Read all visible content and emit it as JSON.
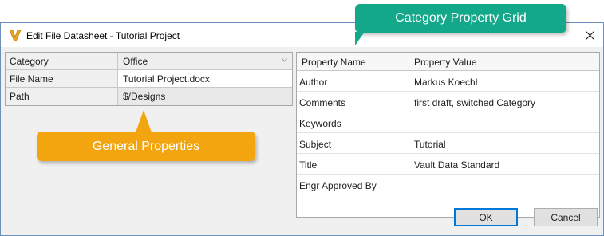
{
  "window": {
    "title": "Edit File Datasheet - Tutorial Project",
    "app_icon": "vault-icon",
    "close_icon": "close-icon"
  },
  "general_properties": {
    "rows": [
      {
        "name": "Category",
        "value": "Office",
        "type": "dropdown"
      },
      {
        "name": "File Name",
        "value": "Tutorial Project.docx",
        "type": "editable"
      },
      {
        "name": "Path",
        "value": "$/Designs",
        "type": "readonly"
      }
    ]
  },
  "property_grid": {
    "headers": {
      "name": "Property Name",
      "value": "Property Value"
    },
    "rows": [
      {
        "name": "Author",
        "value": "Markus Koechl"
      },
      {
        "name": "Comments",
        "value": "first draft, switched Category"
      },
      {
        "name": "Keywords",
        "value": ""
      },
      {
        "name": "Subject",
        "value": "Tutorial"
      },
      {
        "name": "Title",
        "value": "Vault Data Standard"
      },
      {
        "name": "Engr Approved By",
        "value": ""
      }
    ]
  },
  "buttons": {
    "ok": "OK",
    "cancel": "Cancel"
  },
  "callouts": {
    "category_grid": "Category Property Grid",
    "general": "General Properties",
    "colors": {
      "teal": "#14a88b",
      "orange": "#f3a50f"
    }
  }
}
